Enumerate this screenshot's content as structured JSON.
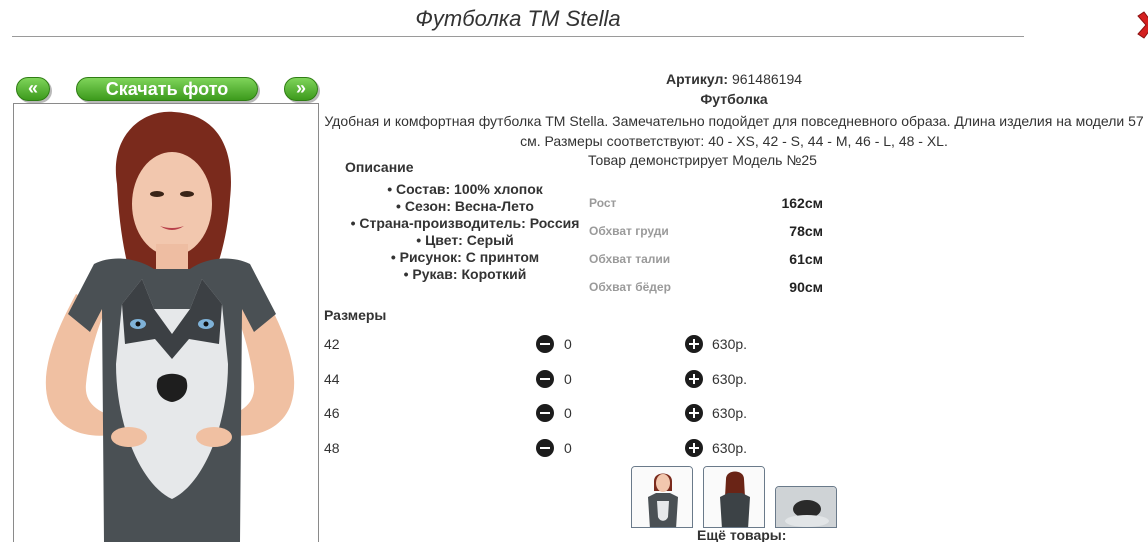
{
  "header": {
    "title": "Футболка ТМ Stella"
  },
  "gallery": {
    "prev_label": "«",
    "next_label": "»",
    "download_label": "Скачать фото"
  },
  "product": {
    "article_label": "Артикул:",
    "article_value": "961486194",
    "type": "Футболка",
    "description": "Удобная и комфортная футболка ТМ Stella. Замечательно подойдет для повседневного образа. Длина изделия на модели 57 см. Размеры соответствуют: 40 - XS, 42 - S, 44 - M, 46 - L, 48 - XL.",
    "model_demo": "Товар демонстрирует Модель №25"
  },
  "specs": {
    "heading": "Описание",
    "items": [
      "Состав: 100% хлопок",
      "Сезон: Весна-Лето",
      "Страна-производитель: Россия",
      "Цвет: Серый",
      "Рисунок: С принтом",
      "Рукав: Короткий"
    ]
  },
  "model_measurements": [
    {
      "label": "Рост",
      "value": "162см"
    },
    {
      "label": "Обхват груди",
      "value": "78см"
    },
    {
      "label": "Обхват талии",
      "value": "61см"
    },
    {
      "label": "Обхват бёдер",
      "value": "90см"
    }
  ],
  "sizes": {
    "heading": "Размеры",
    "rows": [
      {
        "size": "42",
        "qty": "0",
        "price": "630р."
      },
      {
        "size": "44",
        "qty": "0",
        "price": "630р."
      },
      {
        "size": "46",
        "qty": "0",
        "price": "630р."
      },
      {
        "size": "48",
        "qty": "0",
        "price": "630р."
      }
    ]
  },
  "more_label": "Ещё товары:",
  "colors": {
    "button_green": "#4caf2a",
    "close_red": "#d42020",
    "accent_text": "#333333"
  }
}
